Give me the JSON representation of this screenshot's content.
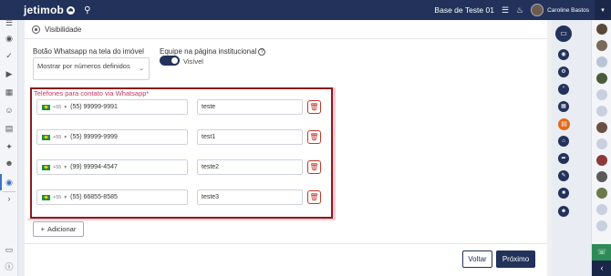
{
  "topbar": {
    "logo": "jetimob",
    "search_icon": "search-icon",
    "base_name": "Base de Teste 01",
    "user_name": "Caroline Bastos",
    "caret": "▾"
  },
  "section": {
    "title": "Visibilidade"
  },
  "form": {
    "whatsapp_button_label": "Botão Whatsapp na tela do imóvel",
    "whatsapp_button_value": "Mostrar por números definidos",
    "team_label": "Equipe na página institucional",
    "team_toggle_label": "Visível",
    "team_toggle_on": true,
    "phones_label": "Telefones para contato via Whatsapp",
    "required_mark": "*",
    "country_code": "+55",
    "phones": [
      {
        "number": "(55) 99999-9991",
        "name": "teste"
      },
      {
        "number": "(55) 99999-9999",
        "name": "test1"
      },
      {
        "number": "(99) 99994-4547",
        "name": "teste2"
      },
      {
        "number": "(55) 66855-8585",
        "name": "teste3"
      }
    ],
    "add_label": "Adicionar"
  },
  "footer": {
    "back_label": "Voltar",
    "next_label": "Próximo"
  },
  "colors": {
    "navy": "#22325a",
    "highlight_border": "#8b1a1a",
    "danger": "#c0392b"
  }
}
